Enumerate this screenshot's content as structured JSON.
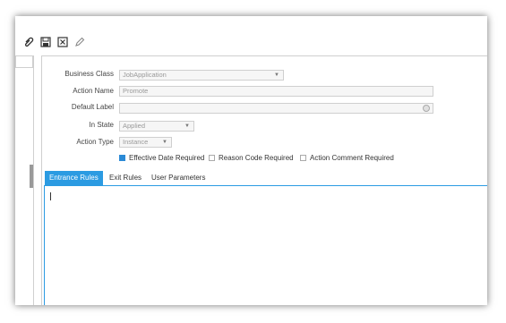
{
  "toolbar": {
    "icons": [
      "paperclip-icon",
      "save-icon",
      "close-box-icon",
      "pencil-icon"
    ]
  },
  "form": {
    "business_class": {
      "label": "Business Class",
      "value": "JobApplication"
    },
    "action_name": {
      "label": "Action Name",
      "value": "Promote"
    },
    "default_label": {
      "label": "Default Label",
      "value": ""
    },
    "in_state": {
      "label": "In State",
      "value": "Applied"
    },
    "action_type": {
      "label": "Action Type",
      "value": "Instance"
    },
    "checkboxes": [
      {
        "label": "Effective Date Required",
        "checked": true
      },
      {
        "label": "Reason Code Required",
        "checked": false
      },
      {
        "label": "Action Comment Required",
        "checked": false
      }
    ]
  },
  "tabs": [
    {
      "label": "Entrance Rules",
      "active": true
    },
    {
      "label": "Exit Rules",
      "active": false
    },
    {
      "label": "User Parameters",
      "active": false
    }
  ],
  "colors": {
    "accent": "#2b9be2",
    "border": "#cfcfcf"
  }
}
